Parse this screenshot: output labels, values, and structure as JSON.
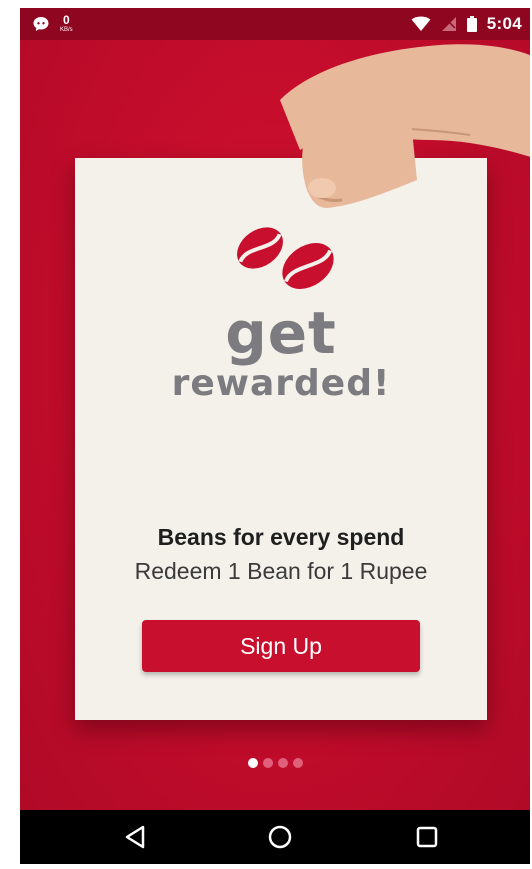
{
  "status_bar": {
    "net_speed_value": "0",
    "net_speed_unit": "KB/s",
    "time": "5:04",
    "icons": [
      "chat-bubble-icon",
      "wifi-icon",
      "no-signal-icon",
      "battery-icon"
    ]
  },
  "onboarding": {
    "logo_top": "get",
    "logo_bottom": "rewarded!",
    "headline": "Beans for every spend",
    "subline": "Redeem 1 Bean for 1 Rupee",
    "signup_label": "Sign Up",
    "page_count": 4,
    "active_page": 1
  },
  "nav_bar": {
    "buttons": [
      "back-icon",
      "home-icon",
      "recents-icon"
    ]
  },
  "colors": {
    "brand_red": "#c10c2b",
    "button_red": "#c8102e",
    "card": "#f3f1ea",
    "logo_gray": "#7b7b80"
  }
}
